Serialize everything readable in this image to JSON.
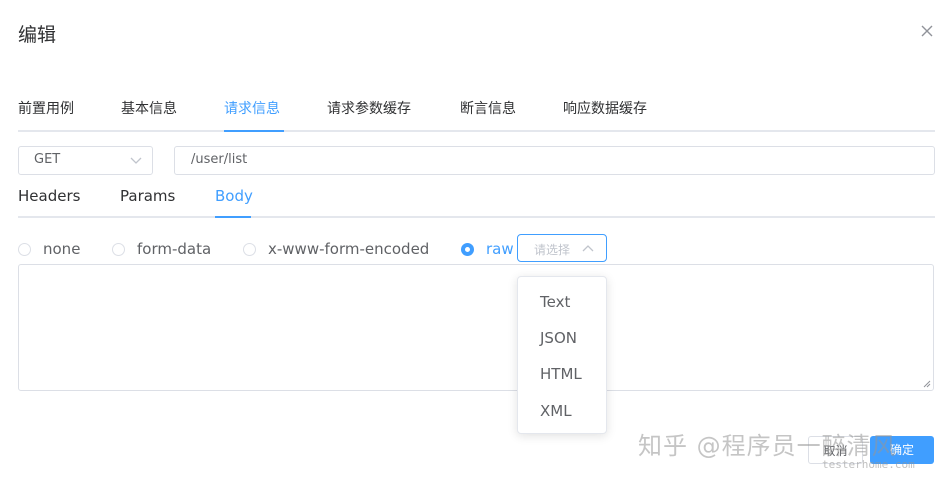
{
  "dialog": {
    "title": "编辑"
  },
  "tabs": [
    {
      "label": "前置用例",
      "active": false
    },
    {
      "label": "基本信息",
      "active": false
    },
    {
      "label": "请求信息",
      "active": true
    },
    {
      "label": "请求参数缓存",
      "active": false
    },
    {
      "label": "断言信息",
      "active": false
    },
    {
      "label": "响应数据缓存",
      "active": false
    }
  ],
  "request": {
    "method": "GET",
    "url": "/user/list"
  },
  "subtabs": [
    {
      "label": "Headers",
      "active": false
    },
    {
      "label": "Params",
      "active": false
    },
    {
      "label": "Body",
      "active": true
    }
  ],
  "body_types": [
    {
      "label": "none",
      "checked": false
    },
    {
      "label": "form-data",
      "checked": false
    },
    {
      "label": "x-www-form-encoded",
      "checked": false
    },
    {
      "label": "raw",
      "checked": true
    }
  ],
  "raw_format": {
    "placeholder": "请选择",
    "options": [
      "Text",
      "JSON",
      "HTML",
      "XML"
    ]
  },
  "footer": {
    "cancel_label": "取消",
    "confirm_label": "确定"
  },
  "watermark": {
    "text": "知乎 @程序员一醉清风",
    "site": "testerhome.com"
  },
  "colors": {
    "accent": "#409eff",
    "border": "#dcdfe6"
  }
}
